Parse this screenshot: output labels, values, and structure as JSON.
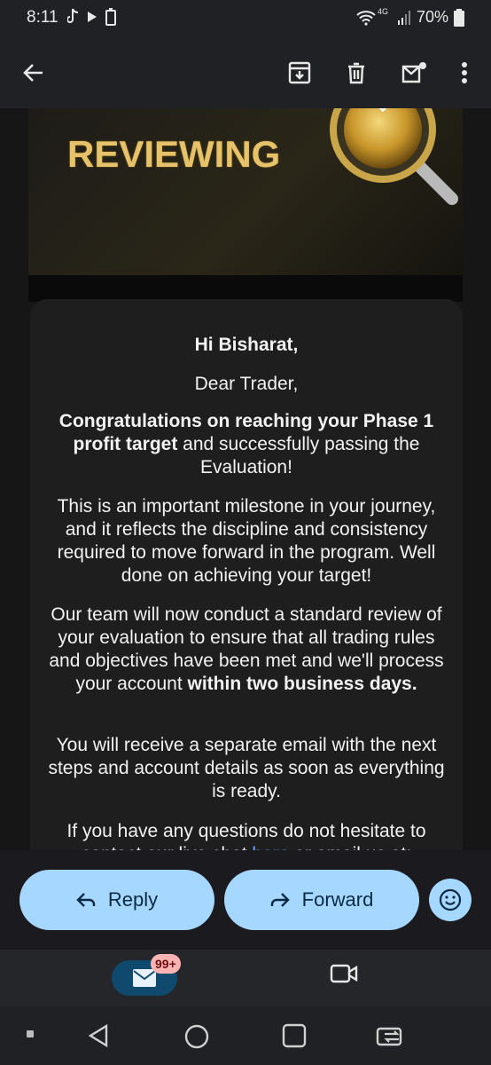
{
  "status_bar": {
    "time": "8:11",
    "network": "4G",
    "battery": "70%"
  },
  "toolbar": {
    "icons": [
      "arrow-back-icon",
      "archive-icon",
      "trash-icon",
      "mark-unread-icon",
      "more-vert-icon"
    ]
  },
  "email": {
    "banner_title": "REVIEWING",
    "greeting": "Hi Bisharat,",
    "salutation": "Dear Trader,",
    "p1_bold": "Congratulations on reaching your Phase 1 profit target",
    "p1_rest": " and successfully passing the Evaluation!",
    "p2": "This is an important milestone in your journey, and it reflects the discipline and consistency required to move forward in the program. Well done on achieving your target!",
    "p3_start": "Our team will now conduct a standard review of your evaluation to ensure that all trading rules and objectives have been met and we'll process your account ",
    "p3_bold": "within two business days.",
    "p4": "You will receive a separate email with the next steps and account details as soon as everything is ready.",
    "p5_start": "If you have any questions do not hesitate to contact our live chat ",
    "p5_link": "here",
    "p5_end": " or email us at:"
  },
  "actions": {
    "reply_label": "Reply",
    "forward_label": "Forward"
  },
  "bottom_nav": {
    "mail_badge": "99+"
  },
  "colors": {
    "accent": "#a6d8ff",
    "banner_gold": "#e6c36a",
    "link": "#6aa8ff"
  }
}
